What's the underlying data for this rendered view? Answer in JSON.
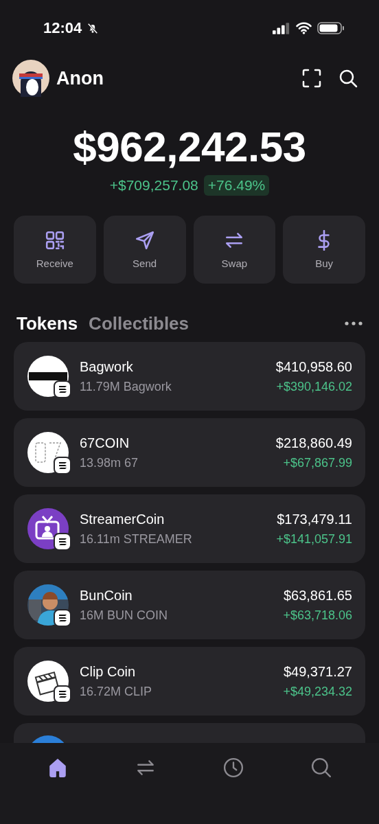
{
  "status_bar": {
    "time": "12:04",
    "silent": true
  },
  "header": {
    "username": "Anon"
  },
  "balance": {
    "total": "$962,242.53",
    "change": "+$709,257.08",
    "change_percent": "+76.49%"
  },
  "actions": [
    {
      "kind": "receive",
      "label": "Receive"
    },
    {
      "kind": "send",
      "label": "Send"
    },
    {
      "kind": "swap",
      "label": "Swap"
    },
    {
      "kind": "buy",
      "label": "Buy"
    }
  ],
  "tabs": [
    {
      "label": "Tokens",
      "selected": true
    },
    {
      "label": "Collectibles",
      "selected": false
    }
  ],
  "tokens": [
    {
      "kind": "bars",
      "name": "Bagwork",
      "amount": "11.79M Bagwork",
      "value": "$410,958.60",
      "change": "+$390,146.02"
    },
    {
      "kind": "numeral",
      "name": "67COIN",
      "amount": "13.98m 67",
      "value": "$218,860.49",
      "change": "+$67,867.99"
    },
    {
      "kind": "tv",
      "name": "StreamerCoin",
      "amount": "16.11m STREAMER",
      "value": "$173,479.11",
      "change": "+$141,057.91"
    },
    {
      "kind": "picture",
      "name": "BunCoin",
      "amount": "16M BUN COIN",
      "value": "$63,861.65",
      "change": "+$63,718.06"
    },
    {
      "kind": "clapper",
      "name": "Clip Coin",
      "amount": "16.72M CLIP",
      "value": "$49,371.27",
      "change": "+$49,234.32"
    }
  ],
  "bottom_nav": [
    {
      "kind": "home",
      "selected": true
    },
    {
      "kind": "swap",
      "selected": false
    },
    {
      "kind": "history",
      "selected": false
    },
    {
      "kind": "search",
      "selected": false
    }
  ]
}
